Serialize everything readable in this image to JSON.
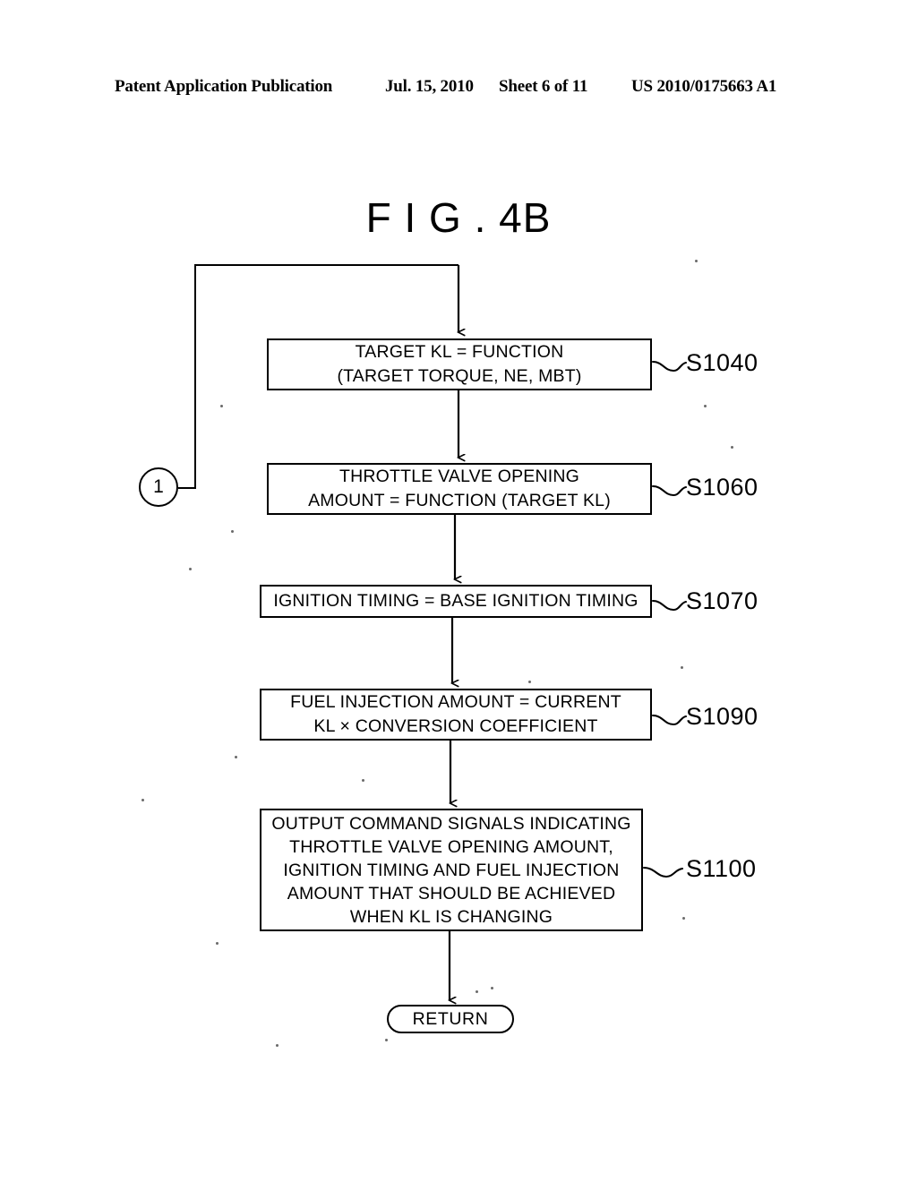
{
  "header": {
    "publication": "Patent Application Publication",
    "date": "Jul. 15, 2010",
    "sheet": "Sheet 6 of 11",
    "patent_number": "US 2010/0175663 A1"
  },
  "figure": {
    "title": "F I G . 4B"
  },
  "flowchart": {
    "connector_label": "1",
    "terminator_label": "RETURN",
    "nodes": [
      {
        "id": "S1040",
        "lines": [
          "TARGET KL = FUNCTION",
          "(TARGET TORQUE, NE, MBT)"
        ],
        "step": "S1040"
      },
      {
        "id": "S1060",
        "lines": [
          "THROTTLE VALVE OPENING",
          "AMOUNT = FUNCTION (TARGET KL)"
        ],
        "step": "S1060"
      },
      {
        "id": "S1070",
        "lines": [
          "IGNITION TIMING = BASE IGNITION TIMING"
        ],
        "step": "S1070"
      },
      {
        "id": "S1090",
        "lines": [
          "FUEL INJECTION AMOUNT = CURRENT",
          "KL × CONVERSION COEFFICIENT"
        ],
        "step": "S1090"
      },
      {
        "id": "S1100",
        "lines": [
          "OUTPUT COMMAND SIGNALS INDICATING",
          "THROTTLE VALVE OPENING AMOUNT,",
          "IGNITION TIMING AND FUEL INJECTION",
          "AMOUNT THAT SHOULD BE ACHIEVED",
          "WHEN KL IS CHANGING"
        ],
        "step": "S1100"
      }
    ]
  },
  "colors": {
    "ink": "#000000",
    "paper": "#ffffff"
  }
}
